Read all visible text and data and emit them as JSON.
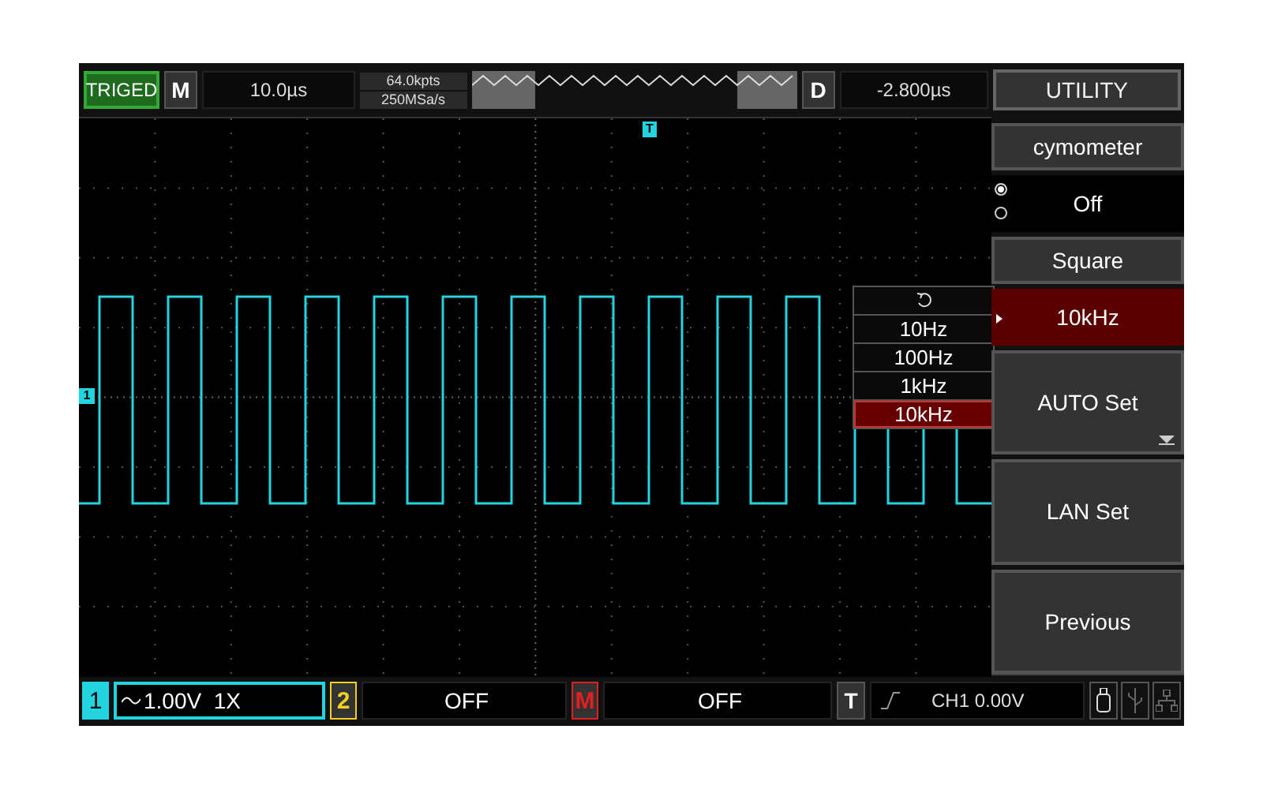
{
  "top_bar": {
    "trigger_status": "TRIGED",
    "timebase_label": "M",
    "timebase": "10.0µs",
    "memory_depth": "64.0kpts",
    "sample_rate": "250MSa/s",
    "delay_label": "D",
    "delay": "-2.800µs",
    "menu_title": "UTILITY"
  },
  "markers": {
    "trigger": "T",
    "channel": "1"
  },
  "dropdown": {
    "options": [
      {
        "label": "10Hz",
        "selected": false
      },
      {
        "label": "100Hz",
        "selected": false
      },
      {
        "label": "1kHz",
        "selected": false
      },
      {
        "label": "10kHz",
        "selected": true
      }
    ]
  },
  "menu": [
    {
      "kind": "title",
      "label": "cymometer"
    },
    {
      "kind": "radio",
      "label": "Off",
      "options": [
        {
          "selected": true
        },
        {
          "selected": false
        }
      ]
    },
    {
      "kind": "title",
      "label": "Square"
    },
    {
      "kind": "value",
      "label": "10kHz"
    },
    {
      "kind": "button",
      "label": "AUTO Set",
      "more": true
    },
    {
      "kind": "button",
      "label": "LAN Set",
      "more": false
    },
    {
      "kind": "button",
      "label": "Previous",
      "more": false
    }
  ],
  "bottom_bar": {
    "channels": [
      {
        "number": "1",
        "value": "1.00V  1X",
        "on": true,
        "color": "#22d3e0"
      },
      {
        "number": "2",
        "value": "OFF",
        "on": false,
        "color": "#f0d020"
      },
      {
        "number": "M",
        "value": "OFF",
        "on": false,
        "color": "#e02020"
      }
    ],
    "trigger_label": "T",
    "trigger_value": "CH1 0.00V"
  }
}
